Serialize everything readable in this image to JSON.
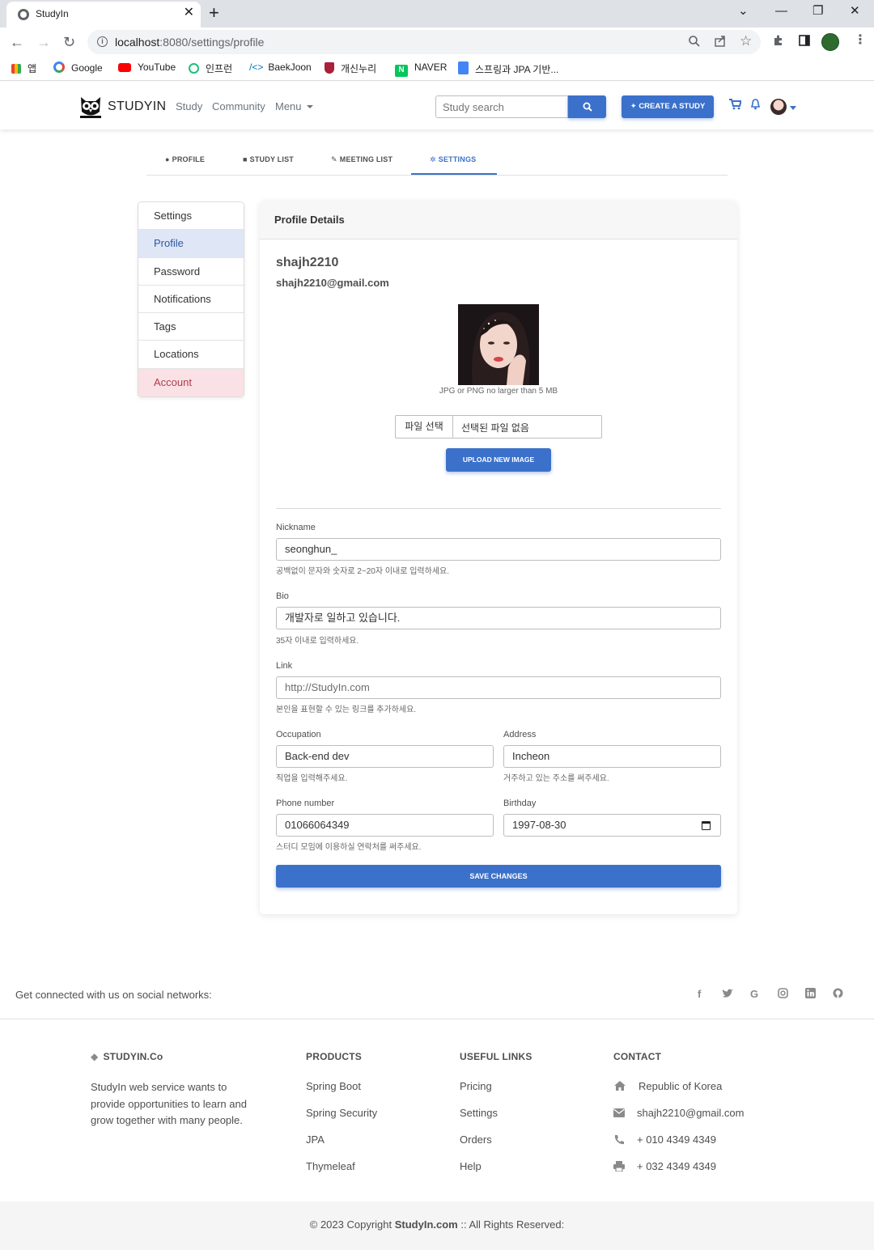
{
  "browser": {
    "tab_title": "StudyIn",
    "url_host": "localhost",
    "url_rest": ":8080/settings/profile",
    "bookmarks": [
      "앱",
      "Google",
      "YouTube",
      "인프런",
      "BaekJoon",
      "개신누리",
      "NAVER",
      "스프링과 JPA 기반..."
    ]
  },
  "navbar": {
    "brand": "STUDYIN",
    "links": [
      "Study",
      "Community",
      "Menu"
    ],
    "search_placeholder": "Study search",
    "create_label": "CREATE A STUDY"
  },
  "profile_tabs": [
    {
      "label": "PROFILE",
      "icon": "user-icon"
    },
    {
      "label": "STUDY LIST",
      "icon": "book-icon"
    },
    {
      "label": "MEETING LIST",
      "icon": "edit-icon"
    },
    {
      "label": "SETTINGS",
      "icon": "cogs-icon"
    }
  ],
  "sidebar": {
    "items": [
      "Settings",
      "Profile",
      "Password",
      "Notifications",
      "Tags",
      "Locations",
      "Account"
    ],
    "active": "Profile"
  },
  "card": {
    "header": "Profile Details",
    "username": "shajh2210",
    "email": "shajh2210@gmail.com",
    "photo_hint": "JPG or PNG no larger than 5 MB",
    "file_button": "파일 선택",
    "file_none": "선택된 파일 없음",
    "upload_label": "UPLOAD NEW IMAGE",
    "save_label": "SAVE CHANGES"
  },
  "form": {
    "nickname": {
      "label": "Nickname",
      "value": "seonghun_",
      "help": "공백없이 문자와 숫자로 2~20자 이내로 입력하세요."
    },
    "bio": {
      "label": "Bio",
      "value": "개발자로 일하고 있습니다.",
      "help": "35자 이내로 입력하세요."
    },
    "link": {
      "label": "Link",
      "placeholder": "http://StudyIn.com",
      "help": "본인을 표현할 수 있는 링크를 추가하세요."
    },
    "occupation": {
      "label": "Occupation",
      "value": "Back-end dev",
      "help": "직업을 입력해주세요."
    },
    "address": {
      "label": "Address",
      "value": "Incheon",
      "help": "거주하고 있는 주소를 써주세요."
    },
    "phone": {
      "label": "Phone number",
      "value": "01066064349",
      "help": "스터디 모임에 이용하실 연락처를 써주세요."
    },
    "birthday": {
      "label": "Birthday",
      "value": "1997-08-30"
    }
  },
  "footer": {
    "social_text": "Get connected with us on social networks:",
    "brand": "STUDYIN.Co",
    "about": "StudyIn web service wants to provide opportunities to learn and grow together with many people.",
    "products_title": "PRODUCTS",
    "products": [
      "Spring Boot",
      "Spring Security",
      "JPA",
      "Thymeleaf"
    ],
    "links_title": "USEFUL LINKS",
    "links": [
      "Pricing",
      "Settings",
      "Orders",
      "Help"
    ],
    "contact_title": "CONTACT",
    "contact": [
      "Republic of Korea",
      "shajh2210@gmail.com",
      "+ 010 4349 4349",
      "+ 032 4349 4349"
    ],
    "copyright_prefix": "© 2023 Copyright ",
    "copyright_brand": "StudyIn.com",
    "copyright_suffix": " :: All Rights Reserved:"
  },
  "colors": {
    "accent": "#3b71ca",
    "active_bg": "#dfe7f6",
    "danger_bg": "#f9e1e5",
    "danger_text": "#b23c4c"
  }
}
